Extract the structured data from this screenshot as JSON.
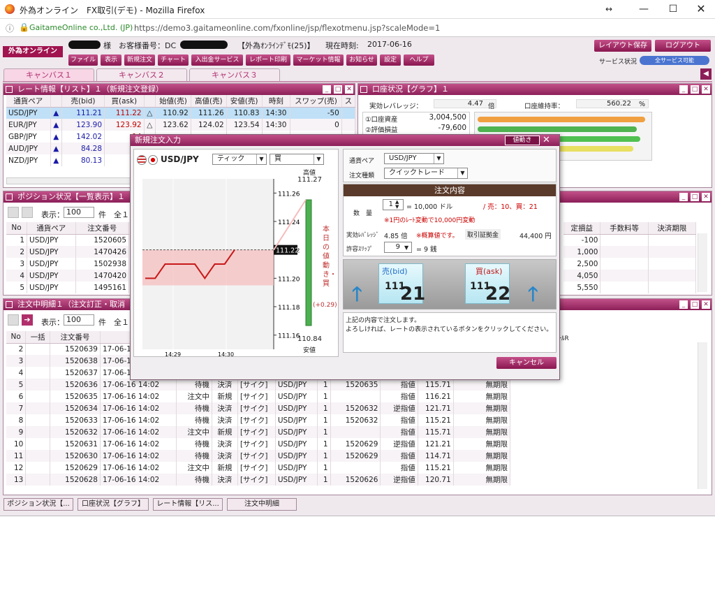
{
  "window": {
    "title": "外為オンライン　FX取引(デモ) - Mozilla Firefox",
    "url_site": "GaitameOnline co.,Ltd. (JP)",
    "url": "https://demo3.gaitameonline.com/fxonline/jsp/flexotmenu.jsp?scaleMode=1"
  },
  "header": {
    "logo": "外為オンライン",
    "sama": "様",
    "customer_label": "お客様番号：DC",
    "account": "【外為ｵﾝﾗｲﾝﾃﾞﾓ(25)】",
    "time_label": "現在時刻:",
    "time_value": "2017-06-16",
    "layout_save": "レイアウト保存",
    "logout": "ログアウト",
    "service_label": "サービス状況",
    "service_status": "全サービス可能"
  },
  "menu": [
    "ファイル",
    "表示",
    "新規注文",
    "チャート",
    "入出金サービス",
    "レポート印刷",
    "マーケット情報",
    "お知らせ",
    "設定",
    "ヘルプ"
  ],
  "canvas_tabs": [
    "キャンバス１",
    "キャンバス２",
    "キャンバス３"
  ],
  "rate_panel": {
    "title": "レート情報【リスト】１（新規注文登録）",
    "headers": [
      "通貨ペア",
      "",
      "売(bid)",
      "買(ask)",
      "",
      "始値(売)",
      "高値(売)",
      "安値(売)",
      "時刻",
      "スワップ(売)",
      "ス"
    ],
    "rows": [
      {
        "pair": "USD/JPY",
        "dir": "▲",
        "bid": "111.21",
        "ask": "111.22",
        "mark": "△",
        "open": "110.92",
        "high": "111.26",
        "low": "110.83",
        "time": "14:30",
        "swap": "-50"
      },
      {
        "pair": "EUR/JPY",
        "dir": "▲",
        "bid": "123.90",
        "ask": "123.92",
        "mark": "△",
        "open": "123.62",
        "high": "124.02",
        "low": "123.54",
        "time": "14:30",
        "swap": "0"
      },
      {
        "pair": "GBP/JPY",
        "dir": "▲",
        "bid": "142.02",
        "ask": "14",
        "mark": "",
        "open": "",
        "high": "",
        "low": "",
        "time": "",
        "swap": ""
      },
      {
        "pair": "AUD/JPY",
        "dir": "▲",
        "bid": "84.28",
        "ask": "8",
        "mark": "",
        "open": "",
        "high": "",
        "low": "",
        "time": "",
        "swap": ""
      },
      {
        "pair": "NZD/JPY",
        "dir": "▲",
        "bid": "80.13",
        "ask": "8",
        "mark": "",
        "open": "",
        "high": "",
        "low": "",
        "time": "",
        "swap": ""
      }
    ]
  },
  "account_panel": {
    "title": "口座状況【グラフ】１",
    "leverage_label": "実効レバレッジ：",
    "leverage_value": "4.47",
    "leverage_unit": "倍",
    "margin_label": "口座維持率：",
    "margin_value": "560.22",
    "margin_unit": "%",
    "items": [
      {
        "label": "①口座資産",
        "value": "3,004,500"
      },
      {
        "label": "②評価損益",
        "value": "-79,600"
      }
    ],
    "bar_fills": [
      1.0,
      0.95,
      0.97,
      0.93
    ],
    "bar_colors": [
      "#f0a040",
      "#4fb34f",
      "#50c050",
      "#e8e060"
    ]
  },
  "position_panel": {
    "title": "ポジション状況【一覧表示】１",
    "display_label": "表示：",
    "count": "100",
    "unit": "件",
    "total": "全１",
    "headers": [
      "No",
      "通貨ペア",
      "注文番号"
    ],
    "rows": [
      {
        "no": "1",
        "pair": "USD/JPY",
        "id": "1520605"
      },
      {
        "no": "2",
        "pair": "USD/JPY",
        "id": "1470426"
      },
      {
        "no": "3",
        "pair": "USD/JPY",
        "id": "1502938"
      },
      {
        "no": "4",
        "pair": "USD/JPY",
        "id": "1470420"
      },
      {
        "no": "5",
        "pair": "USD/JPY",
        "id": "1495161"
      }
    ],
    "right_headers": [
      "定損益",
      "手数料等",
      "決済期限"
    ],
    "right_values": [
      "-100",
      "1,000",
      "2,500",
      "4,050",
      "5,550"
    ]
  },
  "order_panel": {
    "title": "注文中明細１（注文訂正・取消",
    "display_label": "表示：",
    "count": "100",
    "unit": "件",
    "total": "全１",
    "headers": [
      "No",
      "一括",
      "注文番号",
      "注文"
    ],
    "extra_header": "ﾚｰﾙR",
    "rows": [
      {
        "no": "2",
        "id": "1520639",
        "date": "17-06-1",
        "st": "",
        "kind": "",
        "type": "",
        "pair": "",
        "q": "",
        "ref": "",
        "ex": "",
        "price": "",
        "lim": ""
      },
      {
        "no": "3",
        "id": "1520638",
        "date": "17-06-1",
        "st": "",
        "kind": "",
        "type": "",
        "pair": "",
        "q": "",
        "ref": "",
        "ex": "",
        "price": "",
        "lim": ""
      },
      {
        "no": "4",
        "id": "1520637",
        "date": "17-06-1",
        "st": "",
        "kind": "",
        "type": "",
        "pair": "",
        "q": "",
        "ref": "",
        "ex": "",
        "price": "",
        "lim": ""
      },
      {
        "no": "5",
        "id": "1520636",
        "date": "17-06-16 14:02",
        "st": "待機",
        "kind": "決済",
        "type": "[サイク]",
        "pair": "USD/JPY",
        "q": "1",
        "ref": "1520635",
        "ex": "指値",
        "price": "115.71",
        "lim": "無期限"
      },
      {
        "no": "6",
        "id": "1520635",
        "date": "17-06-16 14:02",
        "st": "注文中",
        "kind": "新規",
        "type": "[サイク]",
        "pair": "USD/JPY",
        "q": "1",
        "ref": "",
        "ex": "指値",
        "price": "116.21",
        "lim": "無期限"
      },
      {
        "no": "7",
        "id": "1520634",
        "date": "17-06-16 14:02",
        "st": "待機",
        "kind": "決済",
        "type": "[サイク]",
        "pair": "USD/JPY",
        "q": "1",
        "ref": "1520632",
        "ex": "逆指値",
        "price": "121.71",
        "lim": "無期限"
      },
      {
        "no": "8",
        "id": "1520633",
        "date": "17-06-16 14:02",
        "st": "待機",
        "kind": "決済",
        "type": "[サイク]",
        "pair": "USD/JPY",
        "q": "1",
        "ref": "1520632",
        "ex": "指値",
        "price": "115.21",
        "lim": "無期限"
      },
      {
        "no": "9",
        "id": "1520632",
        "date": "17-06-16 14:02",
        "st": "注文中",
        "kind": "新規",
        "type": "[サイク]",
        "pair": "USD/JPY",
        "q": "1",
        "ref": "",
        "ex": "指値",
        "price": "115.71",
        "lim": "無期限"
      },
      {
        "no": "10",
        "id": "1520631",
        "date": "17-06-16 14:02",
        "st": "待機",
        "kind": "決済",
        "type": "[サイク]",
        "pair": "USD/JPY",
        "q": "1",
        "ref": "1520629",
        "ex": "逆指値",
        "price": "121.21",
        "lim": "無期限"
      },
      {
        "no": "11",
        "id": "1520630",
        "date": "17-06-16 14:02",
        "st": "待機",
        "kind": "決済",
        "type": "[サイク]",
        "pair": "USD/JPY",
        "q": "1",
        "ref": "1520629",
        "ex": "指値",
        "price": "114.71",
        "lim": "無期限"
      },
      {
        "no": "12",
        "id": "1520629",
        "date": "17-06-16 14:02",
        "st": "注文中",
        "kind": "新規",
        "type": "[サイク]",
        "pair": "USD/JPY",
        "q": "1",
        "ref": "",
        "ex": "指値",
        "price": "115.21",
        "lim": "無期限"
      },
      {
        "no": "13",
        "id": "1520628",
        "date": "17-06-16 14:02",
        "st": "待機",
        "kind": "決済",
        "type": "[サイク]",
        "pair": "USD/JPY",
        "q": "1",
        "ref": "1520626",
        "ex": "逆指値",
        "price": "120.71",
        "lim": "無期限"
      }
    ]
  },
  "bottom_tabs": [
    "ポジション状況【...",
    "口座状況【グラフ】",
    "レート情報【リス...",
    "注文中明細"
  ],
  "dialog": {
    "title": "新規注文入力",
    "float_btn": "値動き",
    "pair": "USD/JPY",
    "tick_sel": "ティック",
    "side_sel": "買",
    "high_label": "高値",
    "high_value": "111.27",
    "low_label": "安値",
    "low_value": "110.84",
    "current": "111.22",
    "vertical_note": "本日の値動き・買",
    "change": "(+0.29)",
    "x_ticks": [
      "14:29",
      "14:30"
    ],
    "pair_label": "通貨ペア",
    "pair_value": "USD/JPY",
    "type_label": "注文種類",
    "type_value": "クイックトレード",
    "content_title": "注文内容",
    "qty_label": "数　量",
    "qty_value": "1",
    "qty_eq": "= 10,000 ドル",
    "qty_note": "/ 売：10、買：21",
    "qty_sub": "※1円のﾚｰﾄ変動で10,000円変動",
    "lev_label": "実効ﾚﾊﾞﾚｯｼﾞ",
    "lev_value": "4.85 倍",
    "lev_note": "※概算値です。",
    "margin_label": "取引証拠金",
    "margin_value": "44,400 円",
    "slip_label": "許容ｽﾘｯﾌﾟ",
    "slip_value": "9",
    "slip_eq": "= 9 銭",
    "bid_label": "売(bid)",
    "bid_big": "111.",
    "bid_small": "21",
    "ask_label": "買(ask)",
    "ask_big": "111.",
    "ask_small": "22",
    "msg1": "上記の内容で注文します。",
    "msg2": "よろしければ、レートの表示されているボタンをクリックしてください。",
    "cancel": "キャンセル"
  },
  "chart_data": {
    "type": "line",
    "yticks": [
      "111.26",
      "111.24",
      "111.22",
      "111.20",
      "111.18",
      "111.16"
    ],
    "ylim": [
      111.15,
      111.27
    ],
    "x": [
      "14:29",
      "14:30"
    ],
    "series": [
      {
        "values": [
          111.2,
          111.2,
          111.21,
          111.21,
          111.21,
          111.21,
          111.2,
          111.21,
          111.21,
          111.22
        ]
      }
    ],
    "day_high": "111.27",
    "day_low": "110.84",
    "last": "111.22"
  }
}
